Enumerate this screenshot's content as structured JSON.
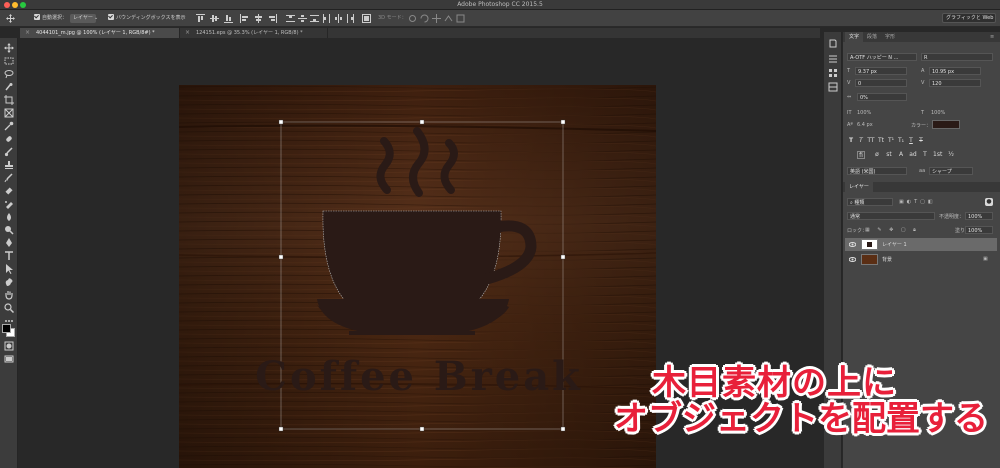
{
  "window": {
    "title": "Adobe Photoshop CC 2015.5"
  },
  "options_bar": {
    "auto_select_label": "自動選択：",
    "auto_select_value": "レイヤー",
    "bounding_box_label": "バウンディングボックスを表示",
    "mode_3d_label": "3D モード：",
    "workspace": "グラフィックと Web"
  },
  "tabs": [
    {
      "label": "4044101_m.jpg @ 100% (レイヤー 1, RGB/8#) *",
      "active": true
    },
    {
      "label": "124151.eps @ 35.3% (レイヤー 1, RGB/8) *",
      "active": false
    }
  ],
  "canvas": {
    "text": "Coffee Break"
  },
  "character_panel": {
    "tabs": [
      "文字",
      "段落",
      "字形"
    ],
    "font_family": "A-OTF ハッピー N ...",
    "font_style": "R",
    "font_size": "9.37 px",
    "leading": "10.95 px",
    "kerning": "0",
    "tracking": "120",
    "tsume": "0%",
    "vertical_scale": "100%",
    "horizontal_scale": "100%",
    "baseline_shift": "6.4 px",
    "color_label": "カラー：",
    "color": "#2a1a16",
    "language": "英語 (米国)",
    "antialias_prefix": "aa",
    "antialias": "シャープ"
  },
  "layers_panel": {
    "tab": "レイヤー",
    "filter": "種類",
    "blend_mode": "通常",
    "opacity_label": "不透明度：",
    "opacity": "100%",
    "lock_label": "ロック：",
    "fill_label": "塗り：",
    "fill": "100%",
    "layers": [
      {
        "name": "レイヤー 1",
        "selected": true
      },
      {
        "name": "背景",
        "selected": false
      }
    ]
  },
  "caption": {
    "line1": "木目素材の上に",
    "line2": "オブジェクトを配置する"
  },
  "colors": {
    "accent": "#e8203a",
    "wood_base": "#4a2611",
    "ink": "#2a1a16"
  }
}
